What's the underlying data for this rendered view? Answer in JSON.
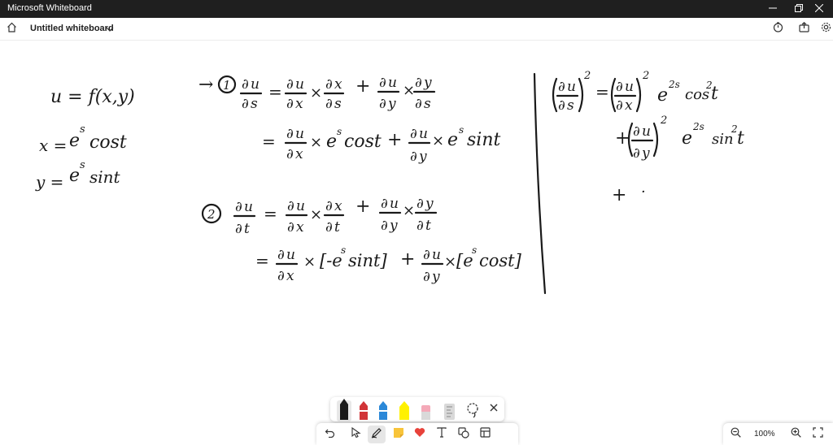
{
  "window": {
    "app_title": "Microsoft Whiteboard",
    "minimize_icon": "minimize-icon",
    "restore_icon": "restore-icon",
    "close_icon": "close-icon"
  },
  "commandbar": {
    "home_icon": "home-icon",
    "board_name": "Untitled whiteboard",
    "dropdown_icon": "chevron-down-icon",
    "timer_icon": "timer-icon",
    "share_icon": "share-icon",
    "settings_icon": "gear-icon"
  },
  "canvas": {
    "left": {
      "line1": "u = f(x,y)",
      "line2_lhs": "x =",
      "line2_e": "e",
      "line2_exp": "s",
      "line2_fn": "cost",
      "line3_lhs": "y =",
      "line3_e": "e",
      "line3_exp": "s",
      "line3_fn": "sint"
    },
    "middle": {
      "arrow": "→",
      "step1_num": "1",
      "step2_num": "2",
      "d": "∂",
      "u": "u",
      "x": "x",
      "y": "y",
      "s": "s",
      "t": "t",
      "eq": "=",
      "times": "×",
      "plus": "+",
      "es_cost": "e",
      "s_sup": "s",
      "cost": "cost",
      "sint": "sint",
      "r2_part1": "[-e",
      "r2_part1_tail": "sint]",
      "r2_part2": "[e",
      "r2_part2_tail": "cost]"
    },
    "right": {
      "sq": "2",
      "e": "e",
      "exp2s": "2s",
      "cos": "cos",
      "sin": "sin",
      "t": "t",
      "plus": "+",
      "dot": "·"
    }
  },
  "pens": {
    "colors": [
      "#1a1a1a",
      "#d13438",
      "#2b88d8",
      "#fff100",
      "#f4a9b8"
    ],
    "names": [
      "pen-black",
      "pen-red",
      "pen-blue",
      "highlighter-yellow",
      "eraser"
    ],
    "ruler_icon": "ruler-icon",
    "lasso_icon": "lasso-icon",
    "close_icon": "close-icon"
  },
  "toolbar": {
    "undo_icon": "undo-icon",
    "select_icon": "select-pointer-icon",
    "pen_icon": "pen-icon",
    "note_icon": "sticky-note-icon",
    "reaction_icon": "heart-icon",
    "text_icon": "text-icon",
    "shapes_icon": "shapes-icon",
    "template_icon": "template-icon"
  },
  "zoom": {
    "zoom_out_icon": "zoom-out-icon",
    "level": "100%",
    "zoom_in_icon": "zoom-in-icon",
    "fit_icon": "fit-screen-icon"
  }
}
